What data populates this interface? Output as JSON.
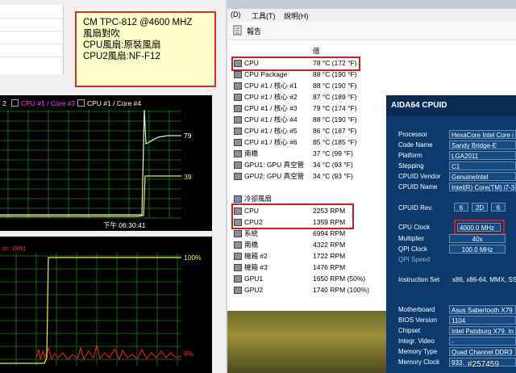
{
  "note": {
    "lines": [
      "CM TPC-812 @4600 MHZ",
      "風扇對吹",
      "CPU風扇:原裝風扇",
      "CPU2風扇:NF-F12"
    ]
  },
  "cpu_graph": {
    "legend": [
      {
        "label": "2",
        "color": "#ffffff"
      },
      {
        "label": "CPU #1 / Core #3",
        "color": "#ff40ff"
      },
      {
        "label": "CPU #1 / Core #4",
        "color": "#ffffff"
      }
    ],
    "value_high": "79",
    "value_low": "39",
    "time_label": "下午 06:30:41"
  },
  "gpu_graph": {
    "top_label": "zh: 19%)",
    "label_100": "100%",
    "label_9": "9%"
  },
  "menu": {
    "items": [
      "(D)",
      "工具(T)",
      "說明(H)"
    ]
  },
  "toolbar": {
    "report_label": "報告"
  },
  "report": {
    "value_header": "值",
    "temps": [
      {
        "name": "CPU",
        "value": "78 °C  (172 °F)"
      },
      {
        "name": "CPU Package",
        "value": "88 °C  (190 °F)"
      },
      {
        "name": "CPU #1 / 核心 #1",
        "value": "88 °C  (190 °F)"
      },
      {
        "name": "CPU #1 / 核心 #2",
        "value": "87 °C  (189 °F)"
      },
      {
        "name": "CPU #1 / 核心 #3",
        "value": "79 °C  (174 °F)"
      },
      {
        "name": "CPU #1 / 核心 #4",
        "value": "88 °C  (190 °F)"
      },
      {
        "name": "CPU #1 / 核心 #5",
        "value": "86 °C  (187 °F)"
      },
      {
        "name": "CPU #1 / 核心 #6",
        "value": "85 °C  (185 °F)"
      },
      {
        "name": "南橋",
        "value": "37 °C  (99 °F)"
      },
      {
        "name": "GPU1: GPU 真空管",
        "value": "34 °C  (93 °F)"
      },
      {
        "name": "GPU2: GPU 真空管",
        "value": "34 °C  (93 °F)"
      }
    ],
    "fan_section": "冷卻風扇",
    "fans": [
      {
        "name": "CPU",
        "value": "2253 RPM"
      },
      {
        "name": "CPU2",
        "value": "1359 RPM"
      },
      {
        "name": "系統",
        "value": "6994 RPM"
      },
      {
        "name": "南橋",
        "value": "4322 RPM"
      },
      {
        "name": "機箱 #2",
        "value": "1722 RPM"
      },
      {
        "name": "機箱 #3",
        "value": "1476 RPM"
      },
      {
        "name": "GPU1",
        "value": "1650 RPM  (50%)"
      },
      {
        "name": "GPU2",
        "value": "1740 RPM  (100%)"
      }
    ]
  },
  "aida": {
    "title": "AIDA64 CPUID",
    "processor": "HexaCore Intel Core i",
    "code_name": "Sandy Bridge-E",
    "platform": "LGA2011",
    "stepping": "C1",
    "cpuid_vendor": "GenuineIntel",
    "cpuid_name": "Intel(R) Core(TM) i7-3",
    "cpu_rev": [
      "6",
      "2D",
      "6"
    ],
    "cpu_clock": "4000.0 MHz",
    "multiplier": "40x",
    "qpi_clock": "100.0 MHz",
    "qpi_speed": "",
    "instruction_set": "x86, x86-64, MMX, SS",
    "motherboard": "Asus Sabertooth X79",
    "bios_version": "1104",
    "chipset": "Intel Patsburg X79, In",
    "integr_video": "-",
    "memory_type": "Quad Channel DDR3",
    "memory_clock": "933.",
    "labels": {
      "processor": "Processor",
      "code_name": "Code Name",
      "platform": "Platform",
      "stepping": "Stepping",
      "cpuid_vendor": "CPUID Vendor",
      "cpuid_name": "CPUID Name",
      "cpu_rev": "CPUID Rev.",
      "cpu_clock": "CPU Clock",
      "multiplier": "Multiplier",
      "qpi_clock": "QPI Clock",
      "qpi_speed": "QPI Speed",
      "instruction_set": "Instruction Set",
      "motherboard": "Motherboard",
      "bios_version": "BIOS Version",
      "chipset": "Chipset",
      "integr_video": "Integr. Video",
      "memory_type": "Memory Type",
      "memory_clock": "Memory Clock"
    }
  },
  "watermark": "#257459"
}
